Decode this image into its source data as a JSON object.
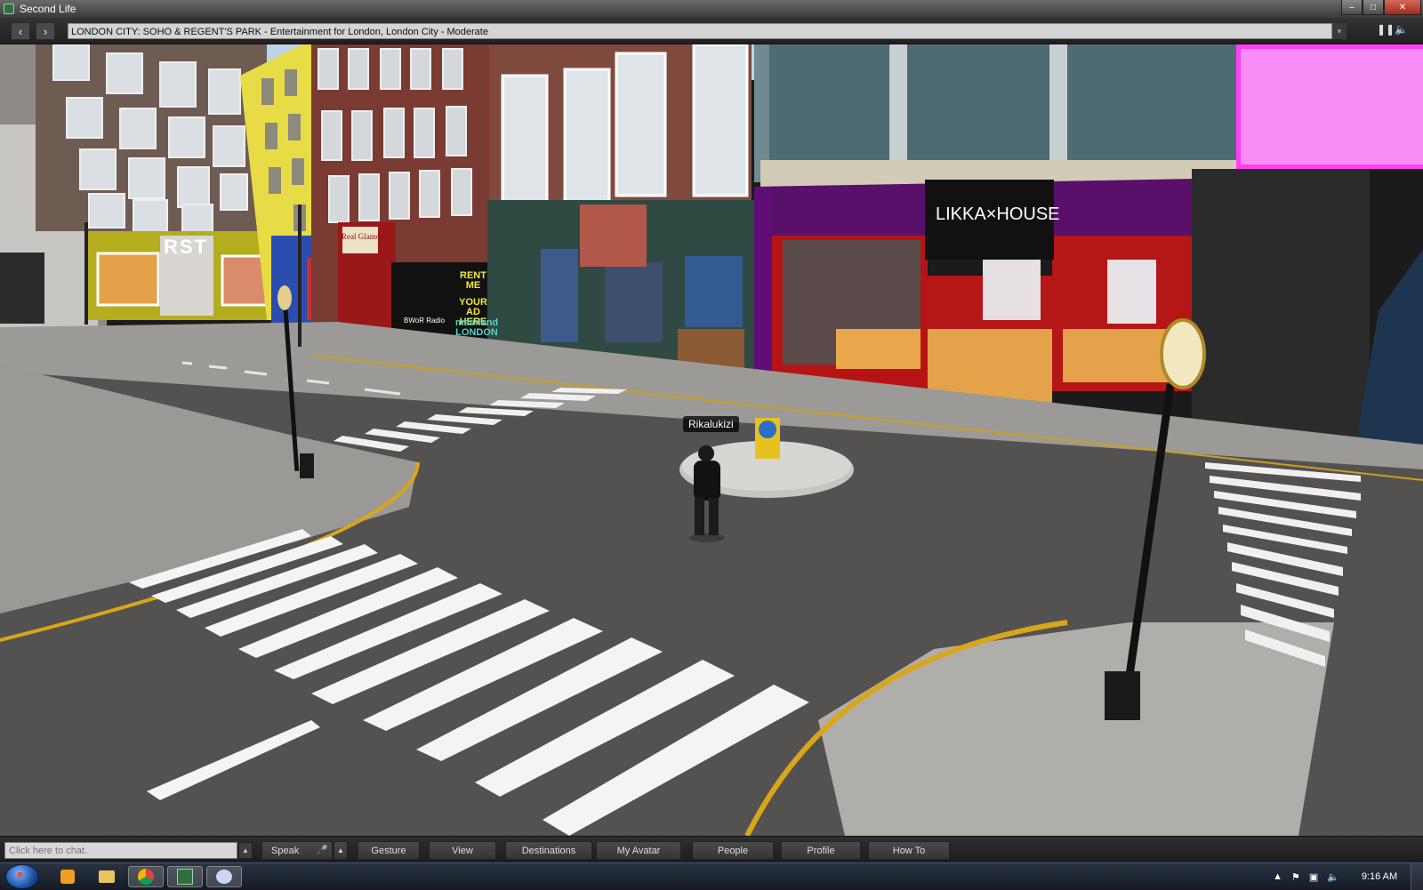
{
  "window": {
    "title": "Second Life"
  },
  "nav": {
    "back_icon": "chevron-left-icon",
    "forward_icon": "chevron-right-icon",
    "location": "LONDON CITY: SOHO & REGENT'S PARK - Entertainment for London, London City - Moderate"
  },
  "scene": {
    "avatar_name": "Rikalukizi",
    "signs": {
      "likka": "LIKKA×HOUSE",
      "rent_me_line1": "RENT ME",
      "rent_me_line2": "YOUR AD",
      "rent_me_line3": "HERE",
      "mainland": "mainland",
      "mainland2": "LONDON",
      "real_glamour": "Real Glamour",
      "rust": "RST",
      "radio": "BWoR Radio"
    }
  },
  "chatbar": {
    "chat_placeholder": "Click here to chat.",
    "buttons": [
      "Speak",
      "Gesture",
      "View",
      "Destinations",
      "My Avatar",
      "People",
      "Profile",
      "How To"
    ]
  },
  "taskbar": {
    "clock": "9:16 AM"
  }
}
